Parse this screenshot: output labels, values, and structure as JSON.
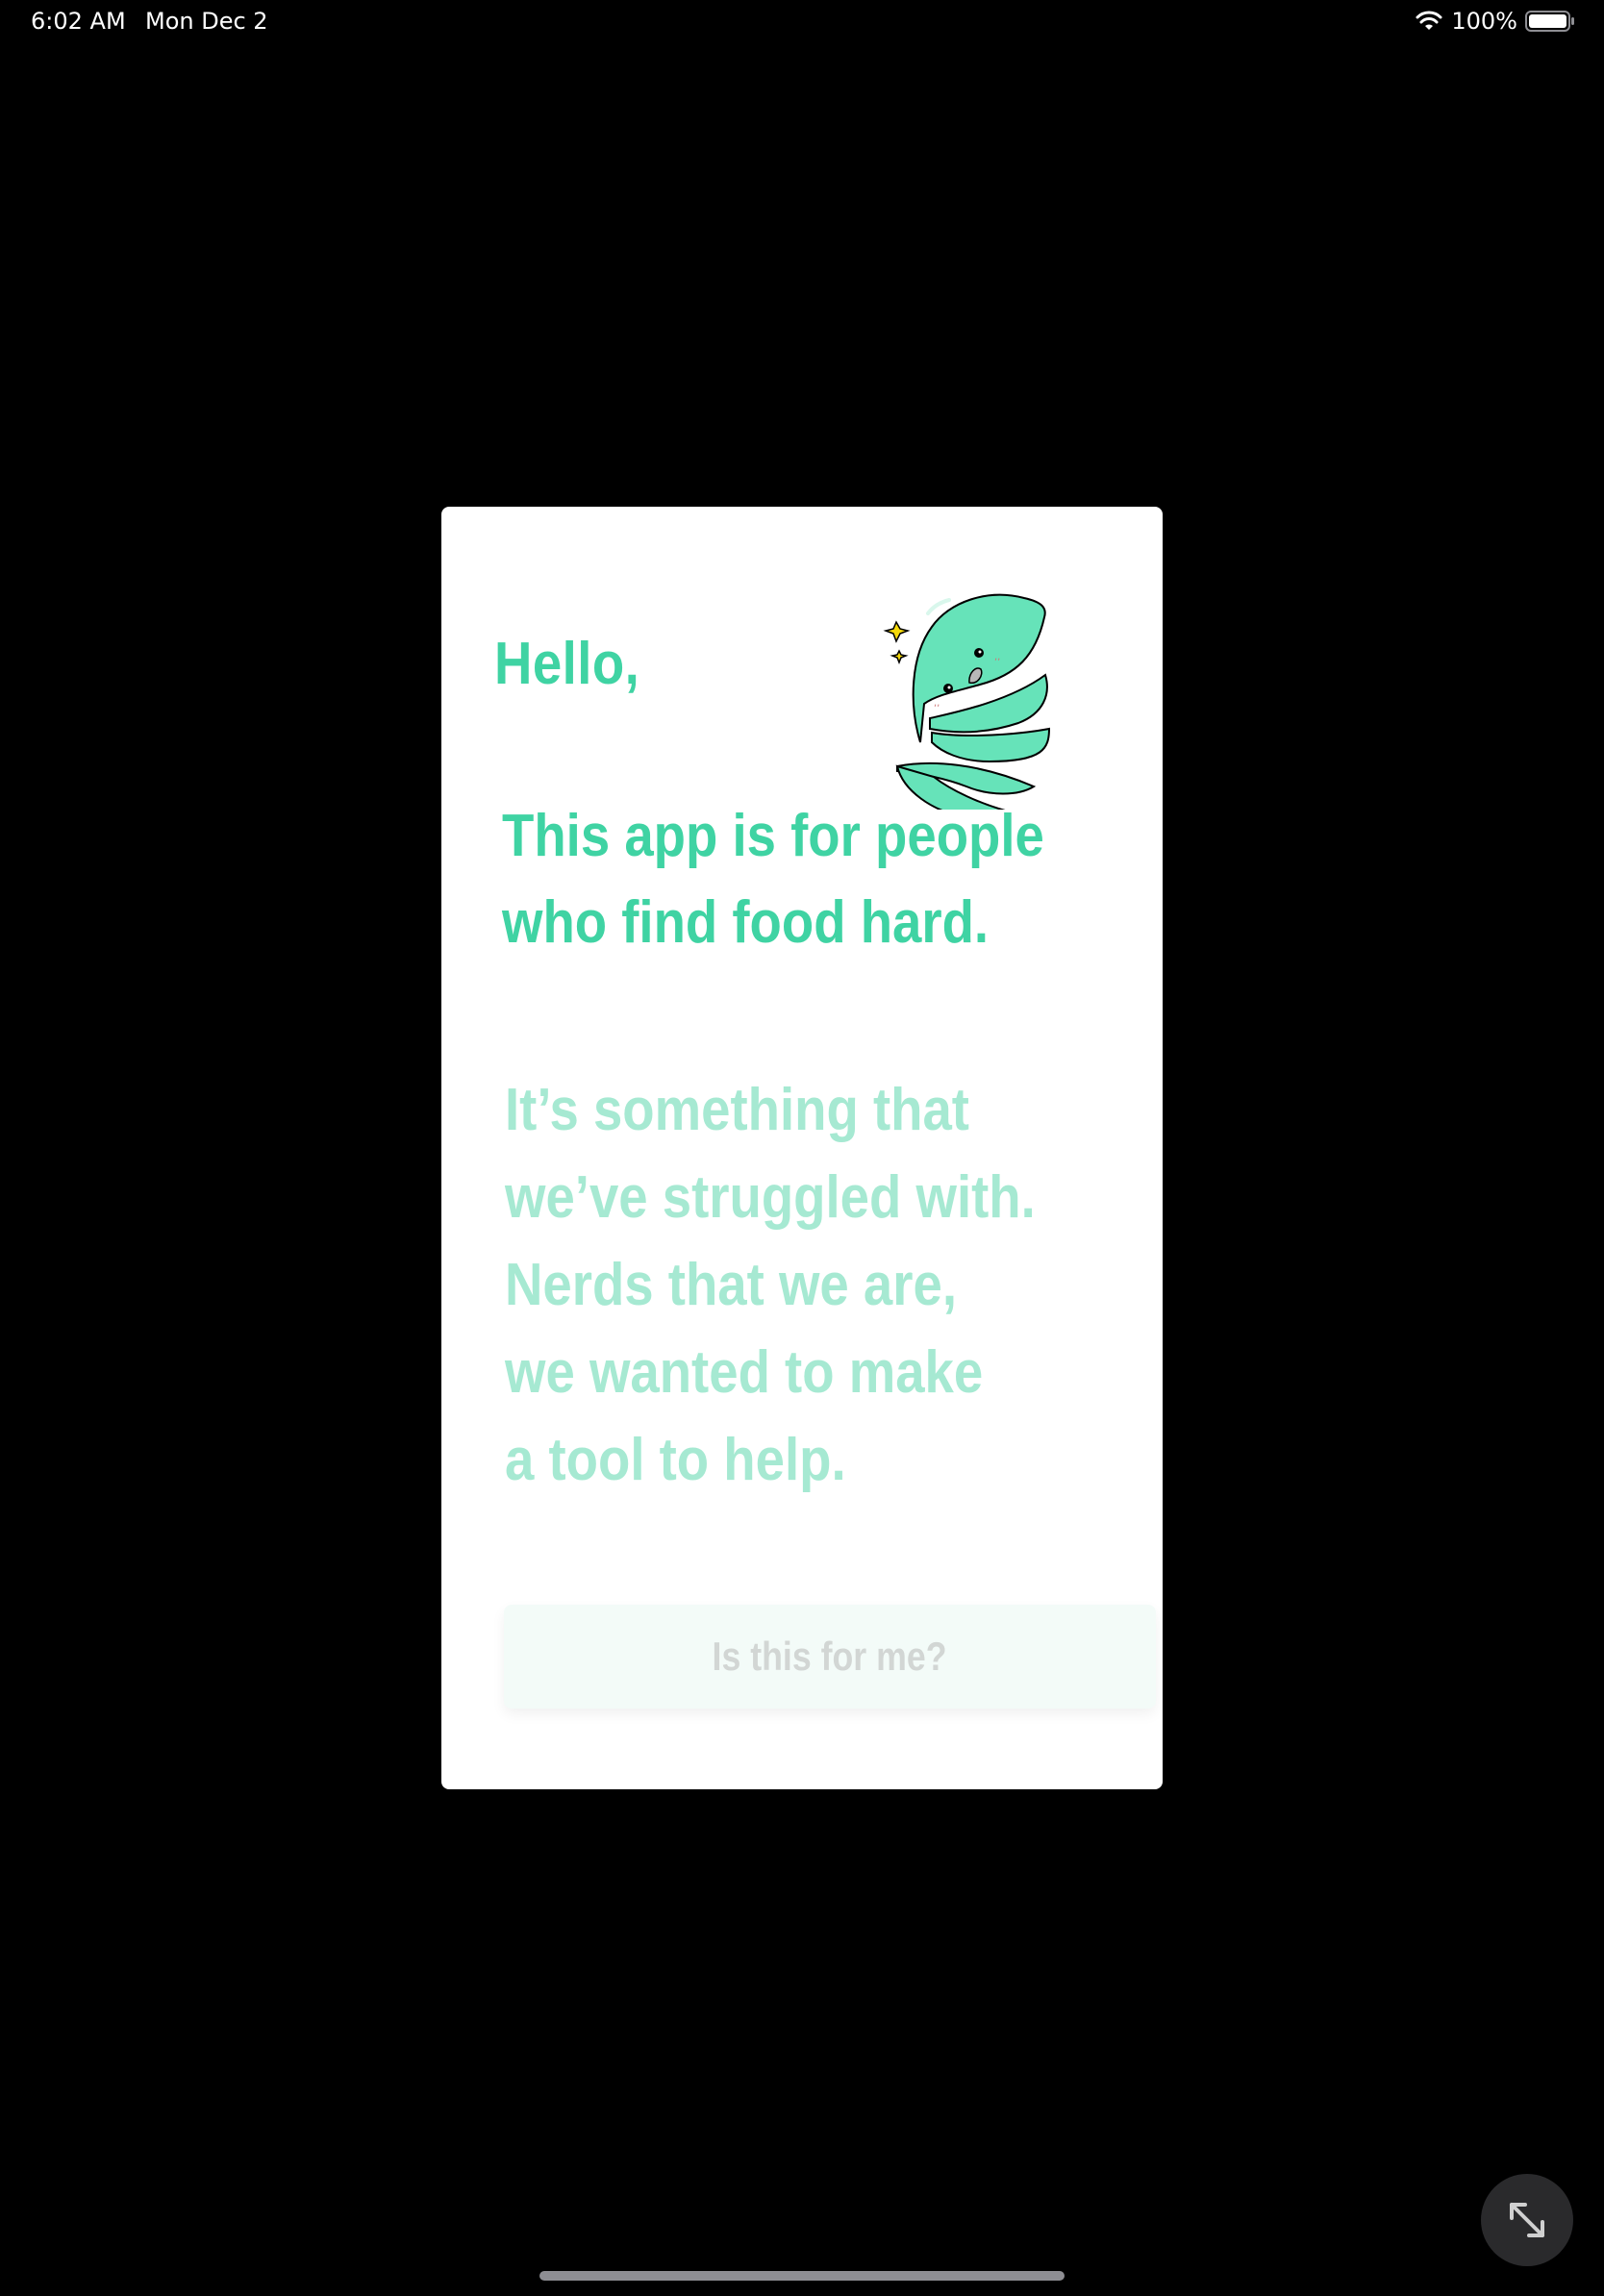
{
  "status_bar": {
    "time": "6:02 AM",
    "date": "Mon Dec 2",
    "battery_percent": "100%",
    "battery_level": 1.0
  },
  "card": {
    "greeting": "Hello,",
    "tagline_lines": [
      "This app is for people",
      "who find food hard."
    ],
    "story_lines": [
      "It’s something that",
      "we’ve struggled with.",
      "Nerds that we are,",
      "we wanted to make",
      "a tool to help."
    ],
    "mascot_icon": "green-blob-mascot-icon",
    "cta_label": "Is this for me?"
  },
  "expand_icon": "expand-arrows-icon",
  "colors": {
    "background": "#000000",
    "card": "#ffffff",
    "accent": "#3fd3a3",
    "accent_light": "#a6e9d2",
    "button_bg": "#f3fbf8",
    "button_text": "#d2d6d4"
  }
}
